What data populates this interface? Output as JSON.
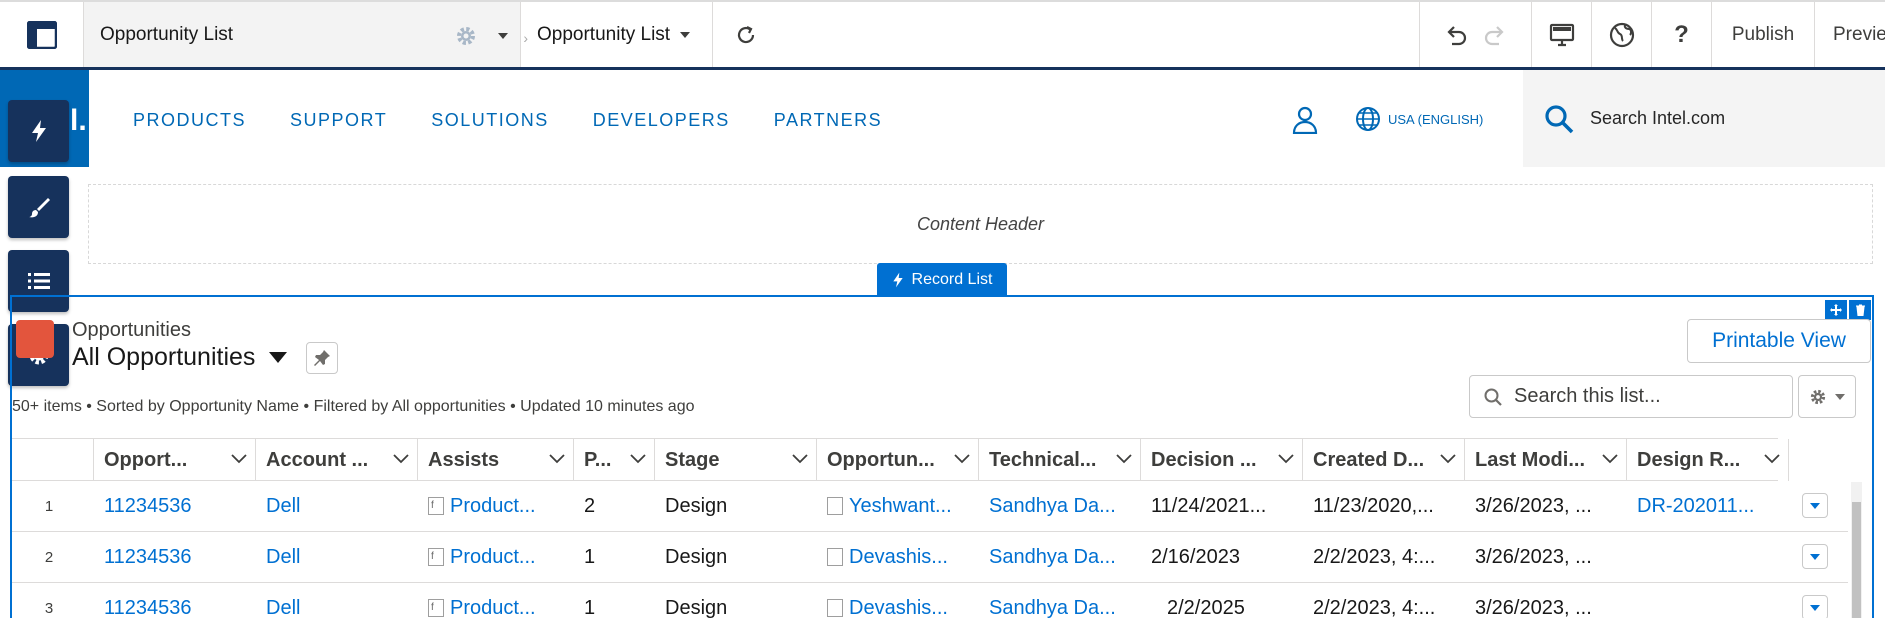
{
  "builder": {
    "page_name": "Opportunity List",
    "page_selector": "Opportunity List",
    "publish_label": "Publish",
    "preview_label": "Preview"
  },
  "site": {
    "logo_text": "l.",
    "nav": [
      "PRODUCTS",
      "SUPPORT",
      "SOLUTIONS",
      "DEVELOPERS",
      "PARTNERS"
    ],
    "language": "USA (ENGLISH)",
    "search_placeholder": "Search Intel.com",
    "brand_color": "#0068b5"
  },
  "content_header_label": "Content Header",
  "record_list": {
    "tab_label": "Record List",
    "object_label": "Opportunities",
    "list_view": "All Opportunities",
    "meta": "50+ items • Sorted by Opportunity Name • Filtered by All opportunities • Updated 10 minutes ago",
    "printable_label": "Printable View",
    "search_placeholder": "Search this list...",
    "columns": [
      "Opport...",
      "Account ...",
      "Assists",
      "P...",
      "Stage",
      "Opportun...",
      "Technical...",
      "Decision ...",
      "Created D...",
      "Last Modi...",
      "Design R..."
    ],
    "rows": [
      {
        "num": "1",
        "cells": [
          "11234536",
          "Dell",
          "Product...",
          "2",
          "Design",
          "Yeshwant...",
          "Sandhya Da...",
          "11/24/2021...",
          "11/23/2020,...",
          "3/26/2023, ...",
          "DR-202011..."
        ]
      },
      {
        "num": "2",
        "cells": [
          "11234536",
          "Dell",
          "Product...",
          "1",
          "Design",
          "Devashis...",
          "Sandhya Da...",
          "2/16/2023",
          "2/2/2023, 4:...",
          "3/26/2023, ...",
          ""
        ]
      },
      {
        "num": "3",
        "cells": [
          "11234536",
          "Dell",
          "Product...",
          "1",
          "Design",
          "Devashis...",
          "Sandhya Da...",
          "2/2/2025",
          "2/2/2023, 4:...",
          "3/26/2023, ...",
          ""
        ]
      }
    ]
  },
  "icons": {
    "menu": "layout-icon",
    "gear": "gear-icon",
    "refresh": "refresh-icon",
    "undo": "undo-icon",
    "redo": "redo-icon",
    "desktop": "desktop-icon",
    "globe": "globe-icon",
    "help": "help-icon"
  }
}
